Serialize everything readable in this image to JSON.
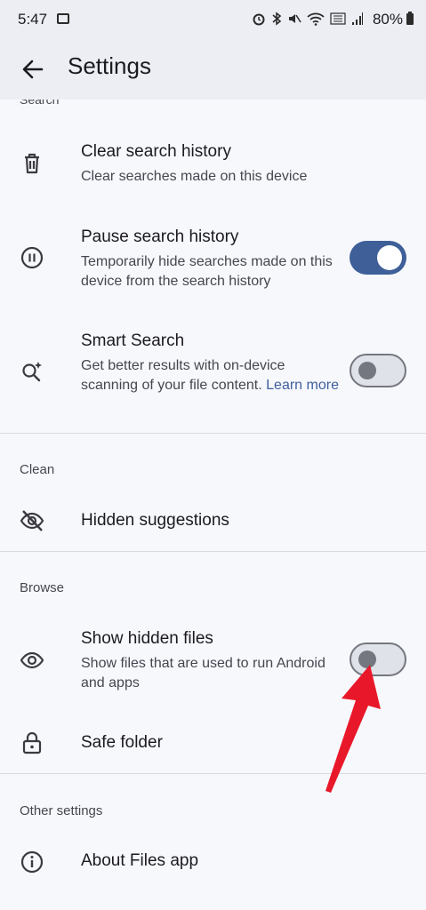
{
  "status_bar": {
    "time": "5:47",
    "battery": "80%"
  },
  "app_bar": {
    "title": "Settings"
  },
  "partial_section": "Search",
  "search_items": {
    "clear": {
      "title": "Clear search history",
      "subtitle": "Clear searches made on this device"
    },
    "pause": {
      "title": "Pause search history",
      "subtitle": "Temporarily hide searches made on this device from the search history",
      "toggle_on": true
    },
    "smart": {
      "title": "Smart Search",
      "subtitle": "Get better results with on-device scanning of your file content.",
      "link": "Learn more",
      "toggle_on": false
    }
  },
  "clean": {
    "header": "Clean",
    "hidden_suggestions": "Hidden suggestions"
  },
  "browse": {
    "header": "Browse",
    "show_hidden": {
      "title": "Show hidden files",
      "subtitle": "Show files that are used to run Android and apps",
      "toggle_on": false
    },
    "safe_folder": "Safe folder"
  },
  "other": {
    "header": "Other settings",
    "about": "About Files app"
  },
  "colors": {
    "accent": "#3e5f98",
    "annotation_arrow": "#e8182a",
    "app_bar_bg": "#edeef4"
  },
  "icons": [
    "image-icon",
    "alarm-icon",
    "bluetooth-icon",
    "mute-icon",
    "wifi-icon",
    "volte-icon",
    "signal-icon",
    "battery-icon",
    "back-arrow-icon",
    "trash-icon",
    "pause-icon",
    "smart-search-icon",
    "eye-off-icon",
    "eye-icon",
    "lock-icon",
    "info-icon"
  ]
}
